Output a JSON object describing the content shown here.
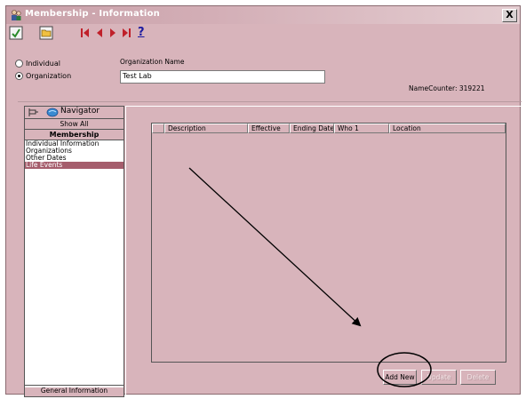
{
  "window": {
    "title": "Membership - Information",
    "close_label": "X"
  },
  "toolbar": {
    "help_label": "?"
  },
  "entity_type": {
    "options": [
      {
        "label": "Individual",
        "selected": false
      },
      {
        "label": "Organization",
        "selected": true
      }
    ]
  },
  "org_name": {
    "label": "Organization Name",
    "value": "Test Lab"
  },
  "name_counter": "NameCounter: 319221",
  "navigator": {
    "title": "Navigator",
    "show_all": "Show All",
    "section": "Membership",
    "items": [
      {
        "label": "Individual Information",
        "selected": false
      },
      {
        "label": "Organizations",
        "selected": false
      },
      {
        "label": "Other Dates",
        "selected": false
      },
      {
        "label": "Life Events",
        "selected": true
      }
    ],
    "footer": "General Information"
  },
  "grid": {
    "columns": [
      "",
      "Description",
      "Effective",
      "Ending Date",
      "Who 1",
      "Location"
    ]
  },
  "actions": {
    "add_new": "Add New",
    "update": "Update",
    "delete": "Delete"
  },
  "colors": {
    "background": "#d8b4bb",
    "selection": "#a55d6c"
  }
}
